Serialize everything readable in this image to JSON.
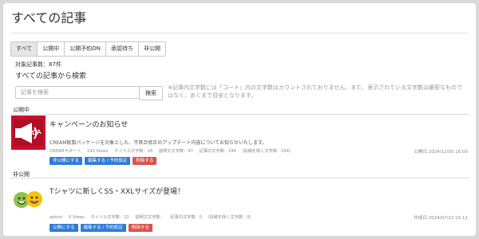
{
  "page": {
    "title": "すべての記事"
  },
  "tabs": [
    {
      "label": "すべて",
      "active": true
    },
    {
      "label": "公開中",
      "active": false
    },
    {
      "label": "公開予約ON",
      "active": false
    },
    {
      "label": "承認待ち",
      "active": false
    },
    {
      "label": "非公開",
      "active": false
    }
  ],
  "summary": {
    "count_label": "対象記事数：",
    "count_value": "87件"
  },
  "search": {
    "heading": "すべての記事から検索",
    "placeholder": "記事を検索",
    "button_label": "検索",
    "note": "※記事内文字数には「コード」内の文字数はカウントされておりません。また、表示されている文字数は厳密なものではなく、あくまで目安となります。"
  },
  "sections": [
    {
      "label": "公開中",
      "post": {
        "thumb_icon": "megaphone-update-icon",
        "title": "キャンペーンのお知らせ",
        "description": "CREAM既製パッケージを対象とした、不具合修正のアップデート内容についてお知らせいたします。",
        "meta": [
          "CREAMサポート",
          "141 Views",
          "タイトル文字数：16",
          "説明文文字数：47",
          "記事内文字数：194",
          "(投稿を除く文字数：194)"
        ],
        "date": "公開日:2024/12/05 16:00",
        "actions": [
          {
            "label": "非公開にする",
            "color": "blue"
          },
          {
            "label": "編集する / 予約設定",
            "color": "blue"
          },
          {
            "label": "削除する",
            "color": "red"
          }
        ]
      }
    },
    {
      "label": "非公開",
      "post": {
        "thumb_icon": "smiley-faces-icon",
        "title": "Tシャツに新しくSS・XXLサイズが登場！",
        "description": "",
        "meta": [
          "admin",
          "0 Views",
          "タイトル文字数：22",
          "説明文文字数：",
          "記事内文字数：0",
          "(投稿を除く文字数：0)"
        ],
        "date": "作成日:2024/07/22 15:11",
        "actions": [
          {
            "label": "公開にする",
            "color": "blue"
          },
          {
            "label": "編集する / 予約設定",
            "color": "blue"
          },
          {
            "label": "削除する",
            "color": "red"
          }
        ]
      }
    }
  ],
  "colors": {
    "primary": "#2f7bd6",
    "danger": "#d9534f",
    "update_red": "#c8102e",
    "smiley_yellow": "#f4c20d",
    "smiley_green": "#8bc34a"
  }
}
